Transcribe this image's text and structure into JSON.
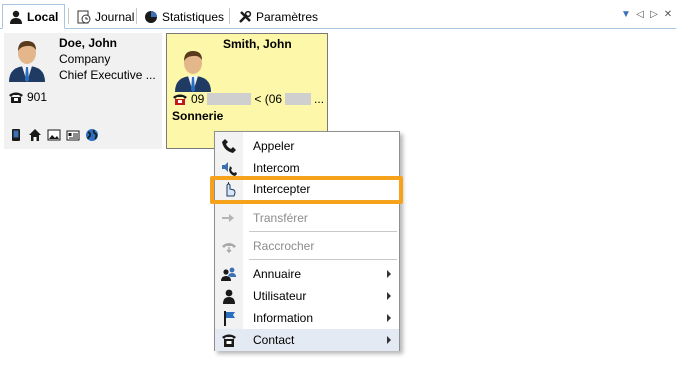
{
  "tabs": [
    {
      "label": "Local",
      "icon": "user-icon",
      "active": true
    },
    {
      "label": "Journal",
      "icon": "journal-icon",
      "active": false
    },
    {
      "label": "Statistiques",
      "icon": "pie-chart-icon",
      "active": false
    },
    {
      "label": "Paramètres",
      "icon": "tools-icon",
      "active": false
    }
  ],
  "tab_controls": [
    "▼",
    "◁",
    "▷",
    "✕"
  ],
  "contacts": [
    {
      "name": "Doe, John",
      "company": "Company",
      "title": "Chief Executive ...",
      "extension": "901"
    },
    {
      "name": "Smith, John",
      "number_left": "09",
      "number_mid": "< (06",
      "number_right": "...",
      "status": "Sonnerie"
    }
  ],
  "menu": {
    "items": [
      {
        "label": "Appeler",
        "icon": "phone-handset-icon"
      },
      {
        "label": "Intercom",
        "icon": "intercom-icon"
      },
      {
        "label": "Intercepter",
        "icon": "intercept-hand-icon",
        "highlighted": true
      },
      {
        "label": "Transférer",
        "icon": "transfer-hand-icon",
        "disabled": true
      },
      {
        "label": "Raccrocher",
        "icon": "hang-up-icon",
        "disabled": true
      },
      {
        "label": "Annuaire",
        "icon": "directory-icon",
        "submenu": true
      },
      {
        "label": "Utilisateur",
        "icon": "user-icon",
        "submenu": true
      },
      {
        "label": "Information",
        "icon": "flag-icon",
        "submenu": true
      },
      {
        "label": "Contact",
        "icon": "desk-phone-icon",
        "submenu": true
      }
    ]
  },
  "colors": {
    "accent": "#3b6fb6",
    "ringing_card": "#fcf7a9",
    "highlight": "#f7a21b",
    "disabled_text": "#8c8c8c"
  }
}
